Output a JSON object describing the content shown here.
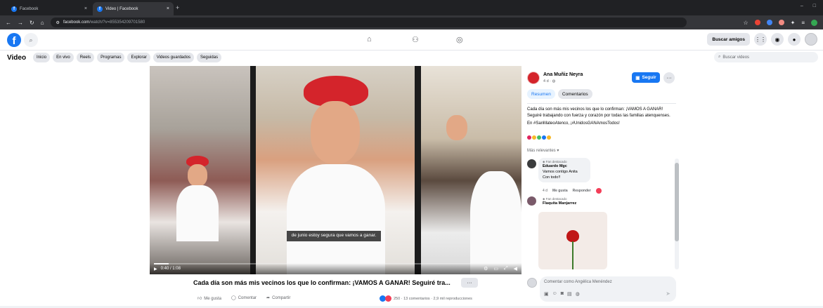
{
  "browser": {
    "tabs": [
      {
        "label": "Facebook",
        "active": false
      },
      {
        "label": "Video | Facebook",
        "active": true
      }
    ],
    "url_host": "facebook.com",
    "url_path": "/watch/?v=855354209701580",
    "new_tab_symbol": "+",
    "window_controls": [
      "–",
      "□"
    ]
  },
  "fb_header": {
    "logo_letter": "f",
    "find_friends_label": "Buscar amigos"
  },
  "subnav": {
    "title": "Video",
    "pills": [
      "Inicio",
      "En vivo",
      "Reels",
      "Programas",
      "Explorar",
      "Videos guardados",
      "Seguidas"
    ],
    "search_placeholder": "Buscar videos"
  },
  "video": {
    "subtitle": "de junio estoy segura que vamos a ganar.",
    "time": "0:40 / 1:08",
    "progress_fraction": 0.04,
    "caption": "Cada día son más mis vecinos los que lo confirman: ¡VAMOS A GANAR! Seguiré tra...",
    "more_label": "···",
    "actions": {
      "like": "Me gusta",
      "comment": "Comentar",
      "share": "Compartir"
    },
    "stats": "250 · 13 comentarios · 2,9 mil reproducciones"
  },
  "panel": {
    "author": "Ana Muñiz Neyra",
    "meta": "4 d · ◍",
    "follow_label": "Seguir",
    "more_label": "···",
    "tabs": [
      "Resumen",
      "Comentarios"
    ],
    "description": "Cada día son más mis vecinos los que lo confirman: ¡VAMOS A GANAR! Seguiré trabajando con fuerza y corazón por todas las familias atenquenses.",
    "hashtags_prefix": "En ",
    "hashtags": "#SanMateoAtenco, ¡#UnidosGANAmosTodos!",
    "relevance_label": "Más relevantes ▾",
    "comments": [
      {
        "badge": "Fan destacado",
        "author": "Eduardo Mgc",
        "text_line1": "Vamos contigo Anita",
        "text_line2": "Con todo!!",
        "age": "4 d",
        "like": "Me gusta",
        "reply": "Responder"
      },
      {
        "badge": "Fan destacado",
        "author": "Flaquita Manjarrez"
      }
    ],
    "composer_placeholder": "Comentar como Angélica Menéndez"
  },
  "colors": {
    "fb_blue": "#1877F2",
    "hearts": [
      "#E0245E",
      "#F7B928",
      "#45BD62",
      "#1877F2",
      "#F7B928"
    ]
  }
}
